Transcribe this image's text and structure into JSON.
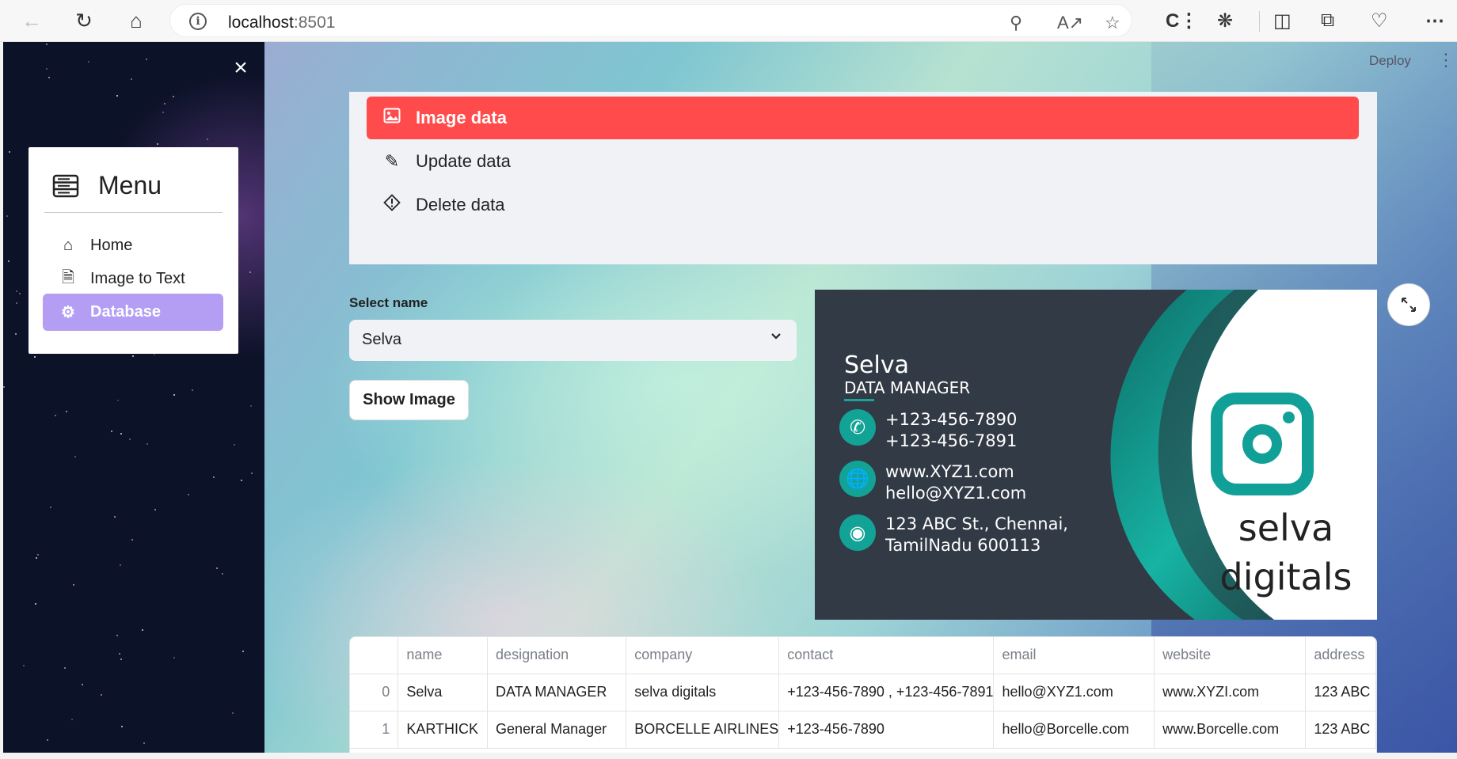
{
  "browser": {
    "url_host": "localhost",
    "url_port": ":8501"
  },
  "header": {
    "deploy_label": "Deploy"
  },
  "sidebar": {
    "menu_title": "Menu",
    "items": [
      {
        "label": "Home",
        "icon": "house-icon"
      },
      {
        "label": "Image to Text",
        "icon": "file-text-icon"
      },
      {
        "label": "Database",
        "icon": "gear-icon",
        "active": true
      }
    ]
  },
  "options": [
    {
      "label": "Image data",
      "icon": "image-icon",
      "active": true
    },
    {
      "label": "Update data",
      "icon": "pencil-icon"
    },
    {
      "label": "Delete data",
      "icon": "warning-diamond-icon"
    }
  ],
  "select": {
    "label": "Select name",
    "value": "Selva"
  },
  "show_image_label": "Show Image",
  "card": {
    "name": "Selva",
    "role": "DATA MANAGER",
    "phone1": "+123-456-7890",
    "phone2": "+123-456-7891",
    "web": "www.XYZ1.com",
    "email": "hello@XYZ1.com",
    "addr1": "123 ABC St., Chennai,",
    "addr2": "TamilNadu 600113",
    "brand1": "selva",
    "brand2": "digitals"
  },
  "table": {
    "columns": [
      "",
      "name",
      "designation",
      "company",
      "contact",
      "email",
      "website",
      "address"
    ],
    "rows": [
      [
        "0",
        "Selva",
        "DATA MANAGER",
        "selva digitals",
        "+123-456-7890 , +123-456-7891",
        "hello@XYZ1.com",
        "www.XYZI.com",
        "123 ABC"
      ],
      [
        "1",
        "KARTHICK",
        "General Manager",
        "BORCELLE AIRLINES",
        "+123-456-7890",
        "hello@Borcelle.com",
        "www.Borcelle.com",
        "123 ABC"
      ]
    ]
  },
  "colors": {
    "accent_red": "#ff4b4b",
    "sidebar_active": "#b49ef4",
    "card_teal": "#13a396"
  }
}
